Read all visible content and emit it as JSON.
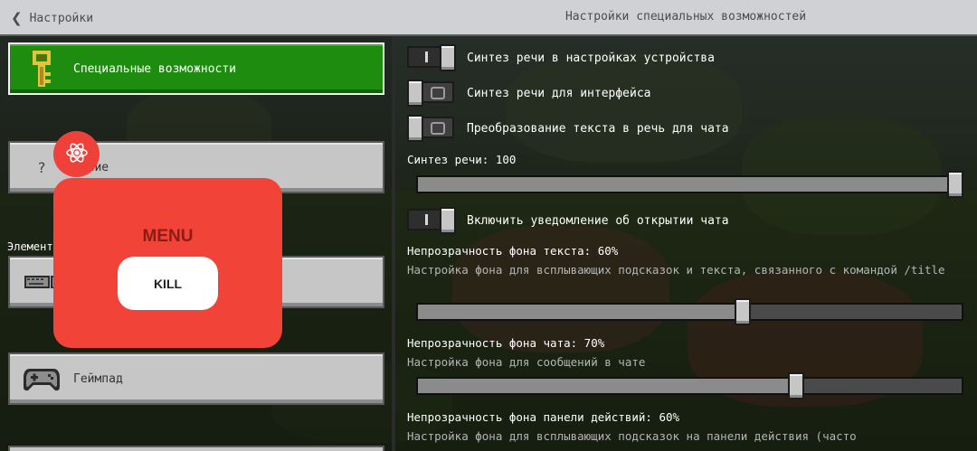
{
  "header": {
    "back_label": "Настройки",
    "title": "Настройки специальных возможностей"
  },
  "sidebar": {
    "items": [
      {
        "label": "Специальные возможности",
        "icon": "key-icon",
        "active": true
      },
      {
        "label": "чение",
        "icon": "question-icon",
        "active": false
      },
      {
        "label": "",
        "icon": "keyboard-mouse-icon",
        "active": false
      },
      {
        "label": "Геймпад",
        "icon": "gamepad-icon",
        "active": false
      }
    ],
    "section_label": "Элемент"
  },
  "settings": {
    "toggles": [
      {
        "label": "Синтез речи в настройках устройства",
        "on": true
      },
      {
        "label": "Синтез речи для интерфейса",
        "on": false
      },
      {
        "label": "Преобразование текста в речь для чата",
        "on": false
      }
    ],
    "speech_slider": {
      "title": "Синтез речи: 100",
      "value": 100
    },
    "chat_notify_toggle": {
      "label": "Включить уведомление об открытии чата",
      "on": true
    },
    "text_bg_slider": {
      "title": "Непрозрачность фона текста: 60%",
      "desc": "Настройка фона для всплывающих подсказок и текста, связанного с командой /title",
      "value": 60
    },
    "chat_bg_slider": {
      "title": "Непрозрачность фона чата: 70%",
      "desc": "Настройка фона для сообщений в чате",
      "value": 70
    },
    "hotbar_bg_slider": {
      "title": "Непрозрачность фона панели действий: 60%",
      "desc": "Настройка фона для всплывающих подсказок на панели действия (часто"
    }
  },
  "overlay": {
    "menu_title": "MENU",
    "kill_label": "KILL",
    "fab_icon": "atom-icon"
  },
  "colors": {
    "active_green": "#1d8c0f",
    "overlay_red": "#f24339",
    "header_bg": "#d0d1d4"
  }
}
